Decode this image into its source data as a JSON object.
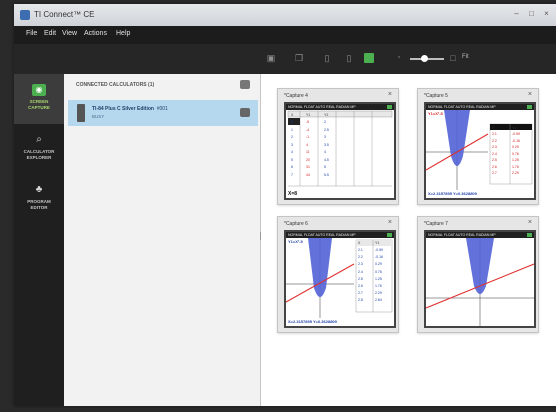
{
  "window": {
    "title": "TI Connect™ CE"
  },
  "menu": [
    "File",
    "Edit",
    "View",
    "Actions",
    "Help"
  ],
  "toolbar": {
    "zoom_label": "Fit"
  },
  "rail": [
    {
      "label": "SCREEN\nCAPTURE",
      "icon": "camera-icon",
      "active": true
    },
    {
      "label": "CALCULATOR\nEXPLORER",
      "icon": "search-icon",
      "active": false
    },
    {
      "label": "PROGRAM\nEDITOR",
      "icon": "sitemap-icon",
      "active": false
    }
  ],
  "devices": {
    "header": "CONNECTED CALCULATORS (1)",
    "items": [
      {
        "name": "TI-84 Plus C Silver Edition",
        "id": "#001",
        "status": "BUSY"
      }
    ]
  },
  "captures": [
    {
      "title": "*Capture 4",
      "status": "NORMAL FLOAT AUTO REAL RADIAN MP",
      "table_cols": [
        "X",
        "Y1",
        "Y2"
      ],
      "table_rows": [
        [
          "0",
          "-5",
          "2"
        ],
        [
          "1",
          "-4",
          "2.5"
        ],
        [
          "2",
          "-1",
          "3"
        ],
        [
          "3",
          "4",
          "3.5"
        ],
        [
          "4",
          "11",
          "4"
        ],
        [
          "5",
          "20",
          "4.5"
        ],
        [
          "6",
          "31",
          "5"
        ],
        [
          "7",
          "44",
          "5.5"
        ]
      ],
      "entry": "X=8"
    },
    {
      "title": "*Capture 5",
      "status": "NORMAL FLOAT AUTO REAL RADIAN MP",
      "label": "Y1=X²-5",
      "bottom": "X=2.3157895   Y=0.3628809",
      "table_cols": [
        "X",
        "Y1"
      ],
      "table_rows": [
        [
          "2.1",
          "-0.59"
        ],
        [
          "2.2",
          "-0.16"
        ],
        [
          "2.3",
          "0.29"
        ],
        [
          "2.4",
          "0.76"
        ],
        [
          "2.5",
          "1.25"
        ],
        [
          "2.6",
          "1.76"
        ],
        [
          "2.7",
          "2.29"
        ]
      ]
    },
    {
      "title": "*Capture 6",
      "status": "NORMAL FLOAT AUTO REAL RADIAN MP",
      "label": "Y1=X²-5",
      "bottom": "X=2.3157895   Y=0.3628809",
      "table_cols": [
        "X",
        "Y1"
      ],
      "table_rows": [
        [
          "2.1",
          "-0.59"
        ],
        [
          "2.2",
          "-0.16"
        ],
        [
          "2.3",
          "0.29"
        ],
        [
          "2.4",
          "0.76"
        ],
        [
          "2.5",
          "1.25"
        ],
        [
          "2.6",
          "1.76"
        ],
        [
          "2.7",
          "2.29"
        ],
        [
          "2.8",
          "2.84"
        ]
      ]
    },
    {
      "title": "*Capture 7",
      "status": "NORMAL FLOAT AUTO REAL RADIAN MP"
    }
  ]
}
